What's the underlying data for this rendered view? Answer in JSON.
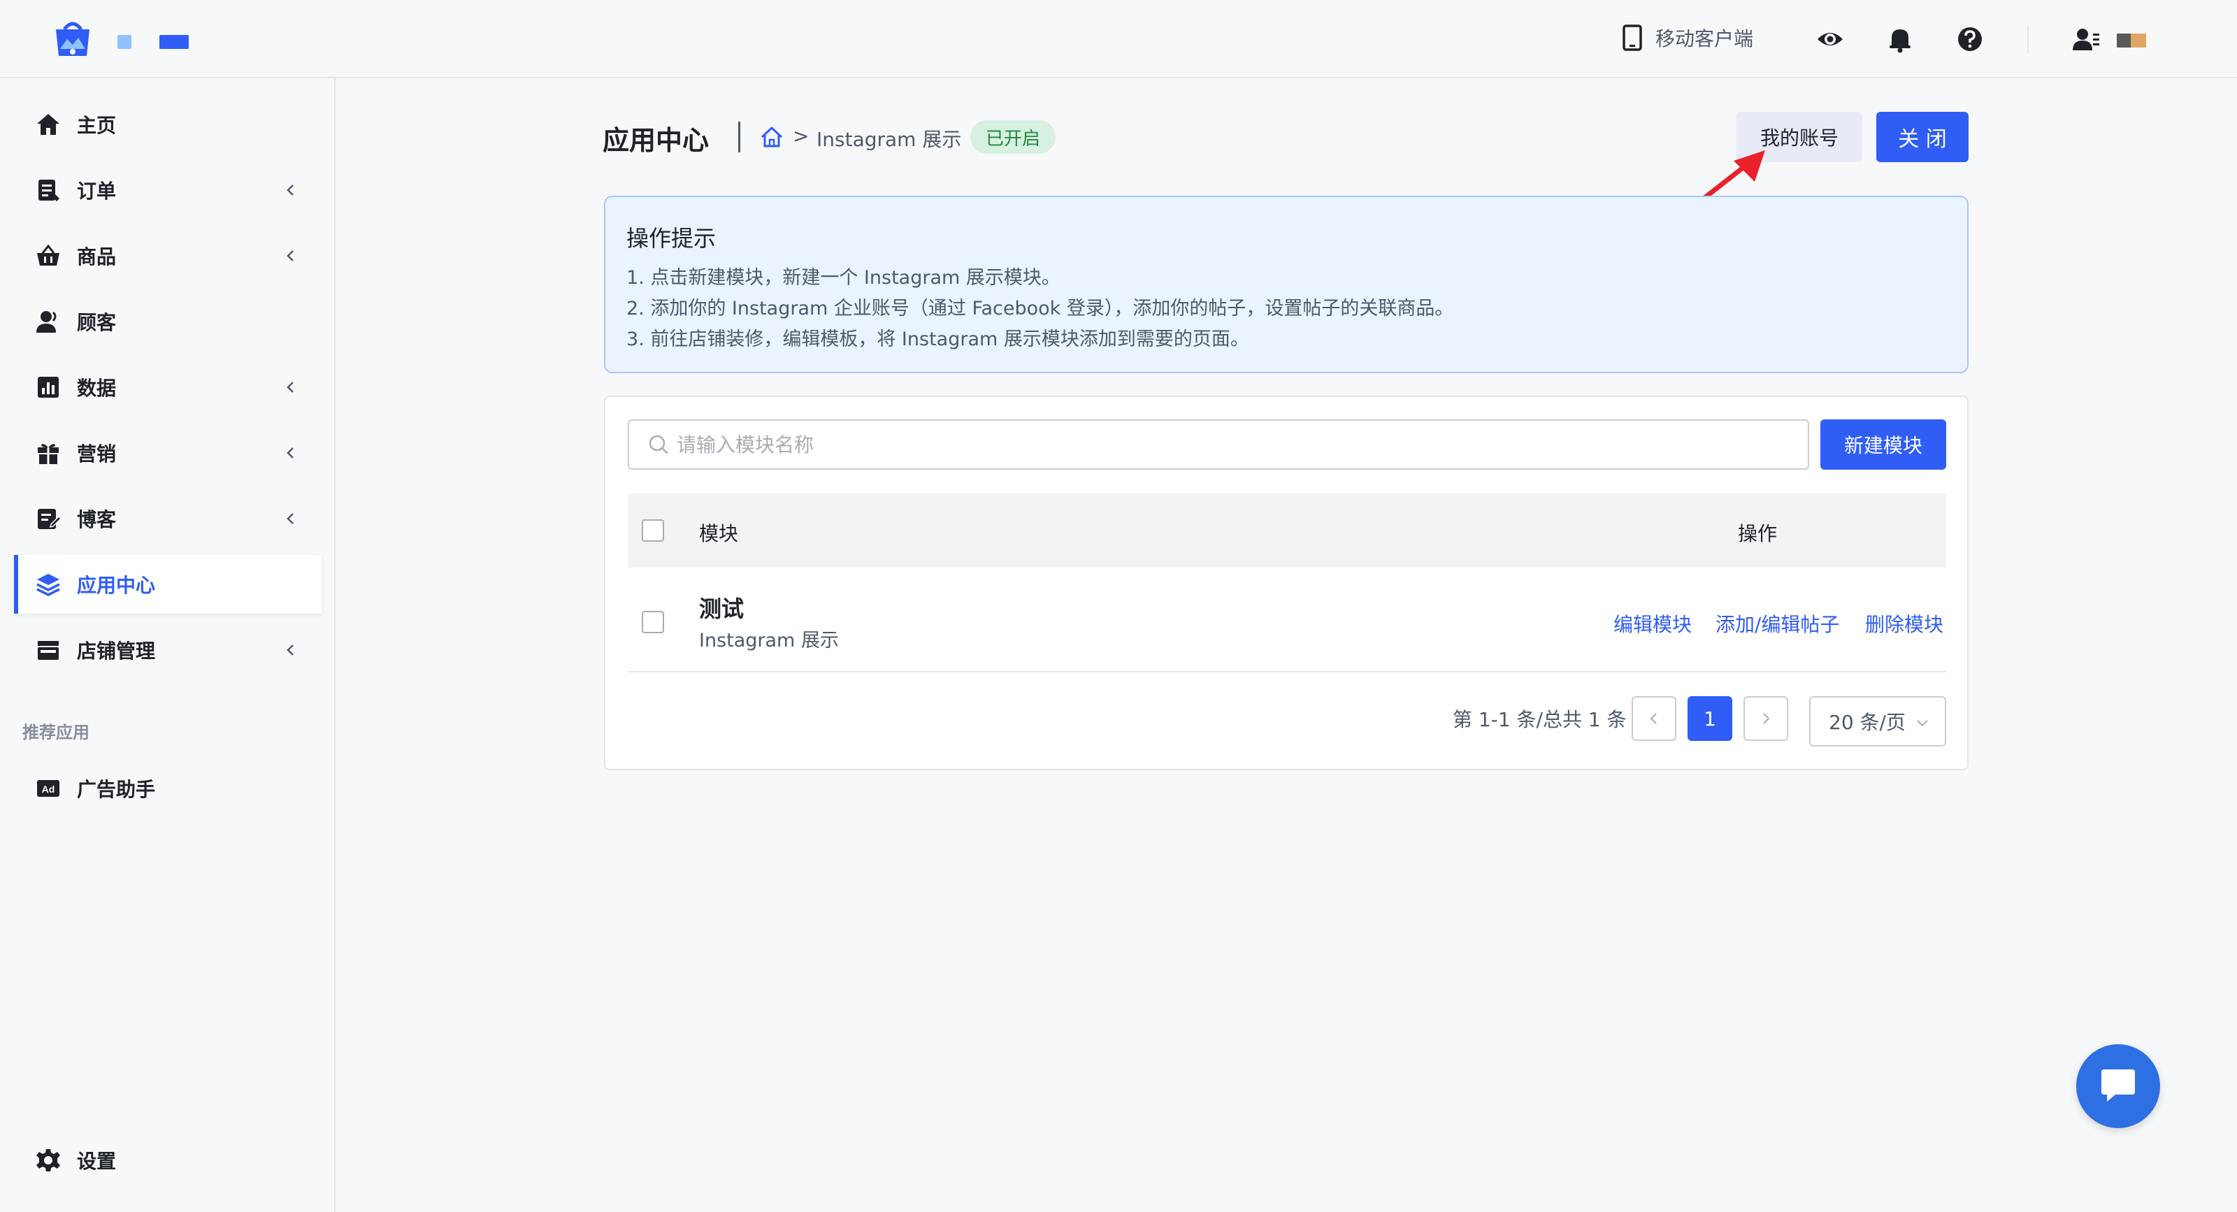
{
  "colors": {
    "accent": "#2f5df5",
    "badge_green": "#1f8a45",
    "tips_bg": "#eaf3ff",
    "arrow_red": "#e8212b"
  },
  "header": {
    "mobile_label": "移动客户端",
    "icons": [
      "eye-icon",
      "bell-icon",
      "help-icon",
      "user-icon"
    ]
  },
  "sidebar": {
    "items": [
      {
        "label": "主页",
        "icon": "home-icon",
        "has_children": false
      },
      {
        "label": "订单",
        "icon": "order-icon",
        "has_children": true
      },
      {
        "label": "商品",
        "icon": "basket-icon",
        "has_children": true
      },
      {
        "label": "顾客",
        "icon": "customer-icon",
        "has_children": false
      },
      {
        "label": "数据",
        "icon": "chart-icon",
        "has_children": true
      },
      {
        "label": "营销",
        "icon": "gift-icon",
        "has_children": true
      },
      {
        "label": "博客",
        "icon": "blog-icon",
        "has_children": true
      },
      {
        "label": "应用中心",
        "icon": "layers-icon",
        "has_children": false,
        "active": true
      },
      {
        "label": "店铺管理",
        "icon": "store-icon",
        "has_children": true
      }
    ],
    "section_label": "推荐应用",
    "recommended": {
      "label": "广告助手",
      "icon": "ad-icon",
      "icon_text": "Ad"
    },
    "settings": {
      "label": "设置",
      "icon": "gear-icon"
    }
  },
  "page": {
    "title": "应用中心",
    "breadcrumb_sep": ">",
    "breadcrumb_current": "Instagram 展示",
    "status_badge": "已开启",
    "account_button": "我的账号",
    "close_button": "关 闭"
  },
  "tips": {
    "title": "操作提示",
    "lines": [
      "1. 点击新建模块，新建一个 Instagram 展示模块。",
      "2. 添加你的 Instagram 企业账号（通过 Facebook 登录），添加你的帖子，设置帖子的关联商品。",
      "3. 前往店铺装修，编辑模板，将 Instagram 展示模块添加到需要的页面。"
    ]
  },
  "table": {
    "search_placeholder": "请输入模块名称",
    "new_button": "新建模块",
    "columns": {
      "module": "模块",
      "actions": "操作"
    },
    "rows": [
      {
        "name": "测试",
        "subtitle": "Instagram 展示",
        "actions": [
          "编辑模块",
          "添加/编辑帖子",
          "删除模块"
        ]
      }
    ]
  },
  "pagination": {
    "summary": "第 1-1 条/总共 1 条",
    "current_page": "1",
    "per_page": "20 条/页"
  }
}
